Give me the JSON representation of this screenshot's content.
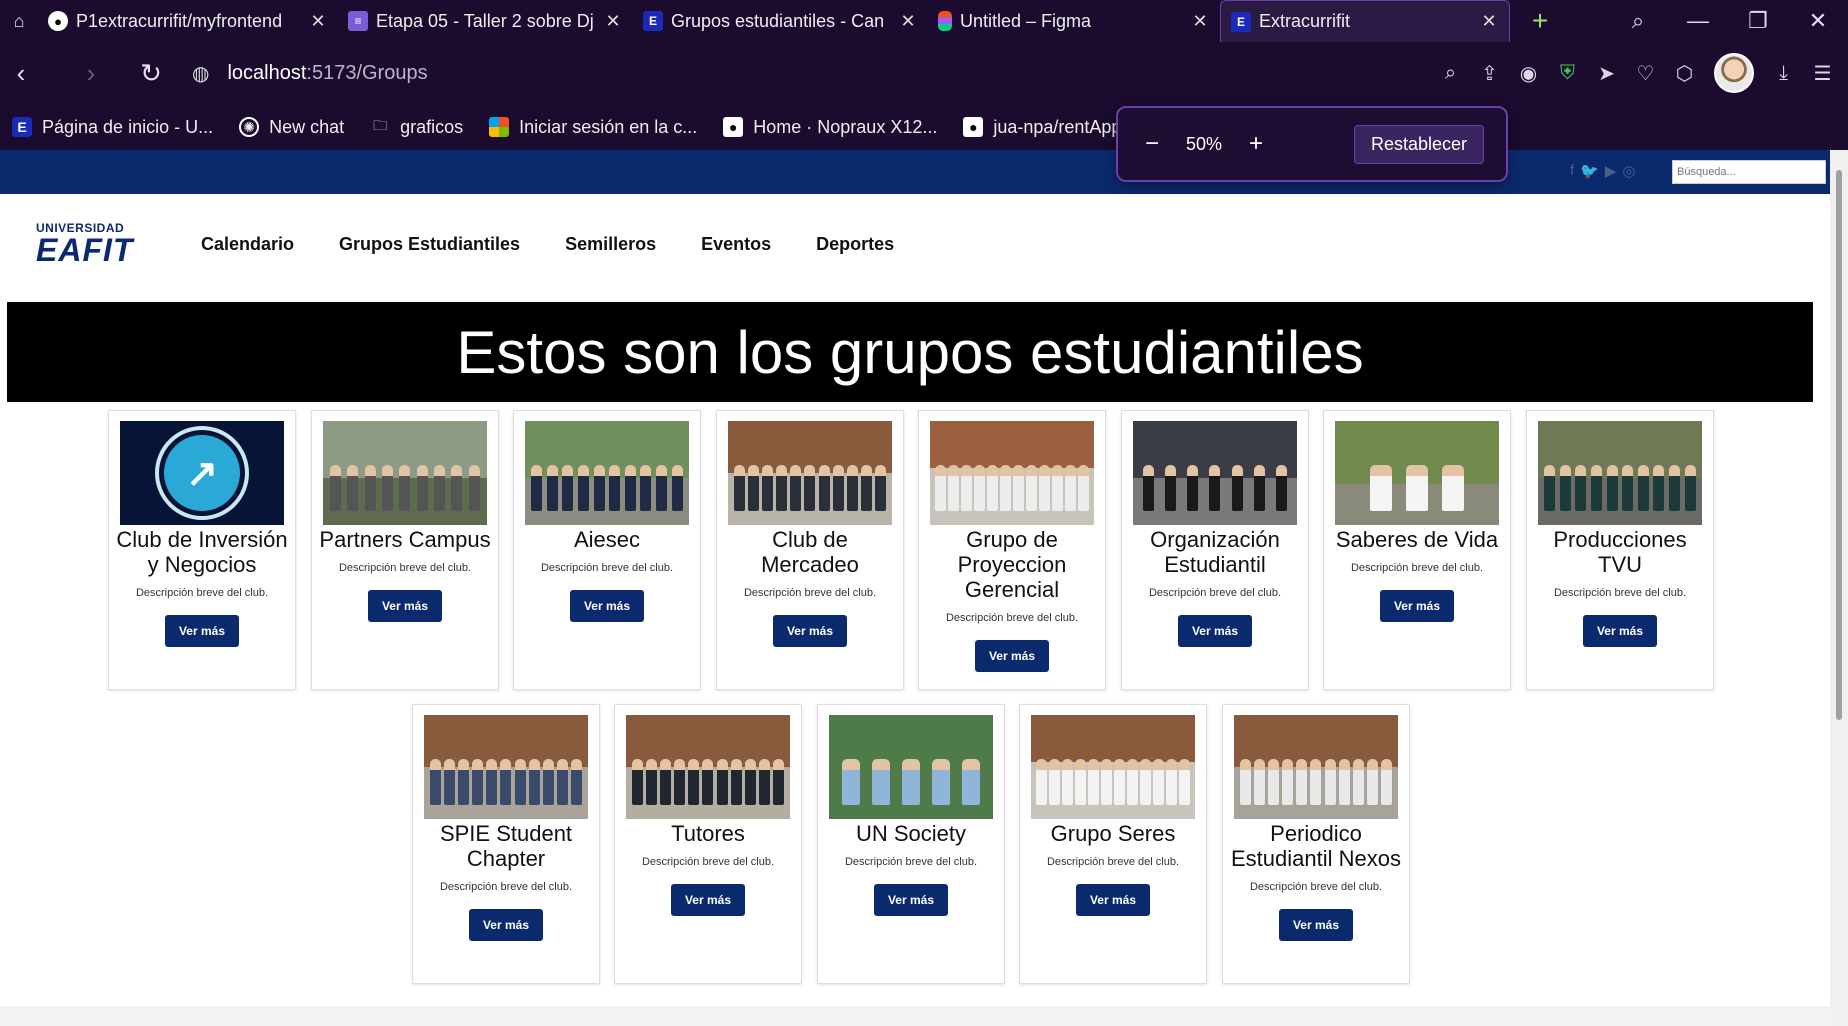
{
  "browser": {
    "tabs": [
      {
        "title": "P1extracurrifit/myfrontend",
        "favicon": "github-icon"
      },
      {
        "title": "Etapa 05 - Taller 2 sobre Dj",
        "favicon": "form-icon"
      },
      {
        "title": "Grupos estudiantiles - Can",
        "favicon": "eafit-icon"
      },
      {
        "title": "Untitled – Figma",
        "favicon": "figma-icon"
      },
      {
        "title": "Extracurrifit",
        "favicon": "eafit-icon",
        "active": true
      }
    ],
    "address": {
      "host": "localhost",
      "path": ":5173/Groups"
    },
    "bookmarks": [
      {
        "label": "Página de inicio - U...",
        "icon": "eafit-icon"
      },
      {
        "label": "New chat",
        "icon": "chatgpt-icon"
      },
      {
        "label": "graficos",
        "icon": "folder-icon"
      },
      {
        "label": "Iniciar sesión en la c...",
        "icon": "microsoft-icon"
      },
      {
        "label": "Home · Nopraux X12...",
        "icon": "github-icon"
      },
      {
        "label": "jua-npa/rentApp",
        "icon": "github-icon"
      }
    ],
    "zoom": {
      "minus": "−",
      "value": "50%",
      "plus": "+",
      "reset_label": "Restablecer"
    }
  },
  "site": {
    "logo": {
      "line1": "UNIVERSIDAD",
      "line2": "EAFIT"
    },
    "search_placeholder": "Búsqueda...",
    "menu": [
      "Calendario",
      "Grupos Estudiantiles",
      "Semilleros",
      "Eventos",
      "Deportes"
    ],
    "hero_title": "Estos son los grupos estudiantiles",
    "groups": [
      {
        "name": "Club de Inversión y Negocios",
        "desc": "Descripción breve del club.",
        "button": "Ver más"
      },
      {
        "name": "Partners Campus",
        "desc": "Descripción breve del club.",
        "button": "Ver más"
      },
      {
        "name": "Aiesec",
        "desc": "Descripción breve del club.",
        "button": "Ver más"
      },
      {
        "name": "Club de Mercadeo",
        "desc": "Descripción breve del club.",
        "button": "Ver más"
      },
      {
        "name": "Grupo de Proyeccion Gerencial",
        "desc": "Descripción breve del club.",
        "button": "Ver más"
      },
      {
        "name": "Organización Estudiantil",
        "desc": "Descripción breve del club.",
        "button": "Ver más"
      },
      {
        "name": "Saberes de Vida",
        "desc": "Descripción breve del club.",
        "button": "Ver más"
      },
      {
        "name": "Producciones TVU",
        "desc": "Descripción breve del club.",
        "button": "Ver más"
      },
      {
        "name": "SPIE Student Chapter",
        "desc": "Descripción breve del club.",
        "button": "Ver más"
      },
      {
        "name": "Tutores",
        "desc": "Descripción breve del club.",
        "button": "Ver más"
      },
      {
        "name": "UN Society",
        "desc": "Descripción breve del club.",
        "button": "Ver más"
      },
      {
        "name": "Grupo Seres",
        "desc": "Descripción breve del club.",
        "button": "Ver más"
      },
      {
        "name": "Periodico Estudiantil Nexos",
        "desc": "Descripción breve del club.",
        "button": "Ver más"
      }
    ]
  },
  "colors": {
    "brand": "#0b2a6e",
    "chrome": "#1b0b2e",
    "accent": "#6c3fb0"
  }
}
